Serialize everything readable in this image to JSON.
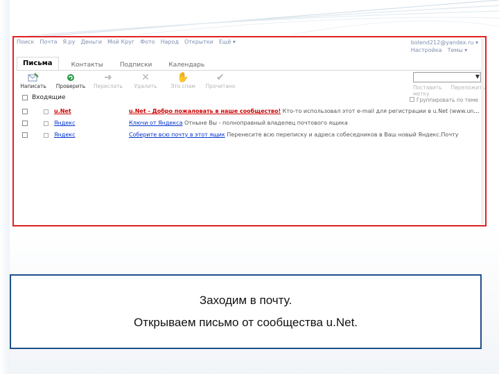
{
  "top_nav": [
    "Поиск",
    "Почта",
    "Я.ру",
    "Деньги",
    "Мой Круг",
    "Фото",
    "Народ",
    "Открытки",
    "Ещё ▾"
  ],
  "user": {
    "email": "bolend212@yandex.ru ▾",
    "settings": "Настройка",
    "themes": "Темы ▾"
  },
  "tabs": [
    {
      "label": "Письма",
      "active": true
    },
    {
      "label": "Контакты",
      "active": false
    },
    {
      "label": "Подписки",
      "active": false
    },
    {
      "label": "Календарь",
      "active": false
    }
  ],
  "toolbar": [
    {
      "label": "Написать",
      "icon": "compose-icon",
      "enabled": true
    },
    {
      "label": "Проверить",
      "icon": "refresh-icon",
      "enabled": true
    },
    {
      "label": "Переслать",
      "icon": "forward-icon",
      "enabled": false
    },
    {
      "label": "Удалить",
      "icon": "delete-icon",
      "enabled": false
    },
    {
      "label": "Это спам",
      "icon": "spam-icon",
      "enabled": false
    },
    {
      "label": "Прочитано",
      "icon": "check-icon",
      "enabled": false
    }
  ],
  "search": {
    "placeholder": "",
    "links": [
      "Поставить метку",
      "Переложить"
    ]
  },
  "folder": {
    "name": "Входящие"
  },
  "group_toggle": "Группировать по теме",
  "messages": [
    {
      "from": "u.Net",
      "subject": "u.Net - Добро пожаловать в наше сообщество!",
      "preview": "Кто-то использовал этот e-mail для регистрации в u.Net (www.unet.com). Если...",
      "unread": true
    },
    {
      "from": "Яндекс",
      "subject": "Ключи от Яндекса",
      "preview": "Отныне Вы - полноправный владелец почтового ящика",
      "unread": false
    },
    {
      "from": "Яндекс",
      "subject": "Соберите всю почту в этот ящик",
      "preview": "Перенесите всю переписку и адреса собеседников в Ваш новый Яндекс.Почту",
      "unread": false
    }
  ],
  "caption": {
    "line1": "Заходим в почту.",
    "line2": "Открываем письмо от сообщества u.Net."
  },
  "colors": {
    "frame_border": "#e02020",
    "caption_border": "#1e4d8c",
    "link": "#0033cc",
    "unread": "#cc0000"
  }
}
